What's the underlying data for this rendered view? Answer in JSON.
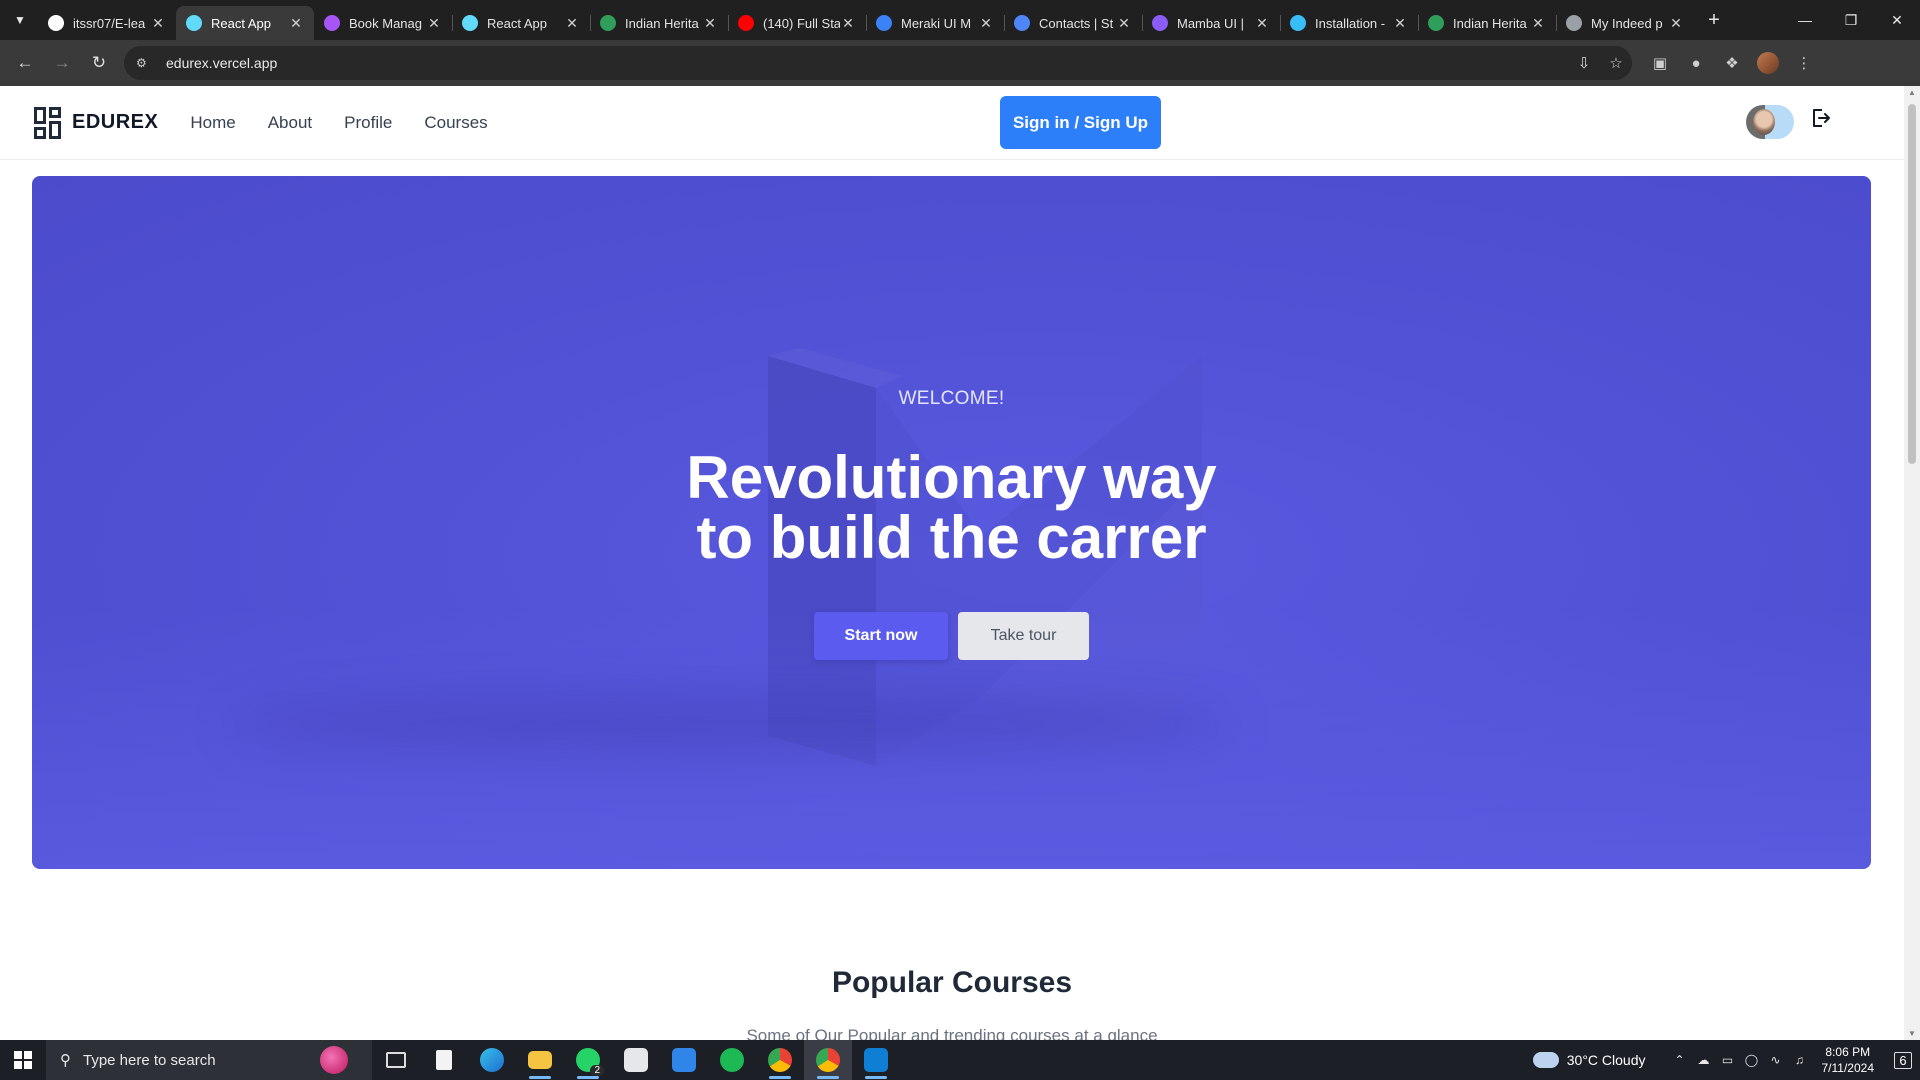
{
  "browser": {
    "tabs": [
      {
        "title": "itssr07/E-lea",
        "favicon": "github-icon",
        "color": "#ffffff",
        "active": false
      },
      {
        "title": "React App",
        "favicon": "react-icon",
        "color": "#61dafb",
        "active": true
      },
      {
        "title": "Book Manag",
        "favicon": "vite-icon",
        "color": "#a855f7",
        "active": false
      },
      {
        "title": "React App",
        "favicon": "react-icon",
        "color": "#61dafb",
        "active": false
      },
      {
        "title": "Indian Herita",
        "favicon": "globe-icon",
        "color": "#2f9e5b",
        "active": false
      },
      {
        "title": "(140) Full Sta",
        "favicon": "youtube-icon",
        "color": "#ff0000",
        "active": false
      },
      {
        "title": "Meraki UI M",
        "favicon": "meraki-icon",
        "color": "#3b82f6",
        "active": false
      },
      {
        "title": "Contacts | St",
        "favicon": "contacts-icon",
        "color": "#4f86f7",
        "active": false
      },
      {
        "title": "Mamba UI |",
        "favicon": "mamba-icon",
        "color": "#8b5cf6",
        "active": false
      },
      {
        "title": "Installation -",
        "favicon": "tailwind-icon",
        "color": "#38bdf8",
        "active": false
      },
      {
        "title": "Indian Herita",
        "favicon": "globe-icon",
        "color": "#2f9e5b",
        "active": false
      },
      {
        "title": "My Indeed p",
        "favicon": "globe-icon",
        "color": "#9aa0a6",
        "active": false
      }
    ],
    "url": "edurex.vercel.app"
  },
  "site": {
    "brand": "EDUREX",
    "nav": [
      "Home",
      "About",
      "Profile",
      "Courses"
    ],
    "signin_label": "Sign in / Sign Up",
    "accent": "#2d7ff9"
  },
  "hero": {
    "welcome": "WELCOME!",
    "headline_line1": "Revolutionary way",
    "headline_line2": "to build the carrer",
    "start_label": "Start now",
    "tour_label": "Take tour",
    "bg_color": "#5252d6"
  },
  "popular": {
    "title": "Popular Courses",
    "subtitle": "Some of Our Popular and trending courses at a glance"
  },
  "taskbar": {
    "search_placeholder": "Type here to search",
    "whatsapp_badge": "2",
    "weather": "30°C  Cloudy",
    "time": "8:06 PM",
    "date": "7/11/2024",
    "notifications": "6"
  }
}
